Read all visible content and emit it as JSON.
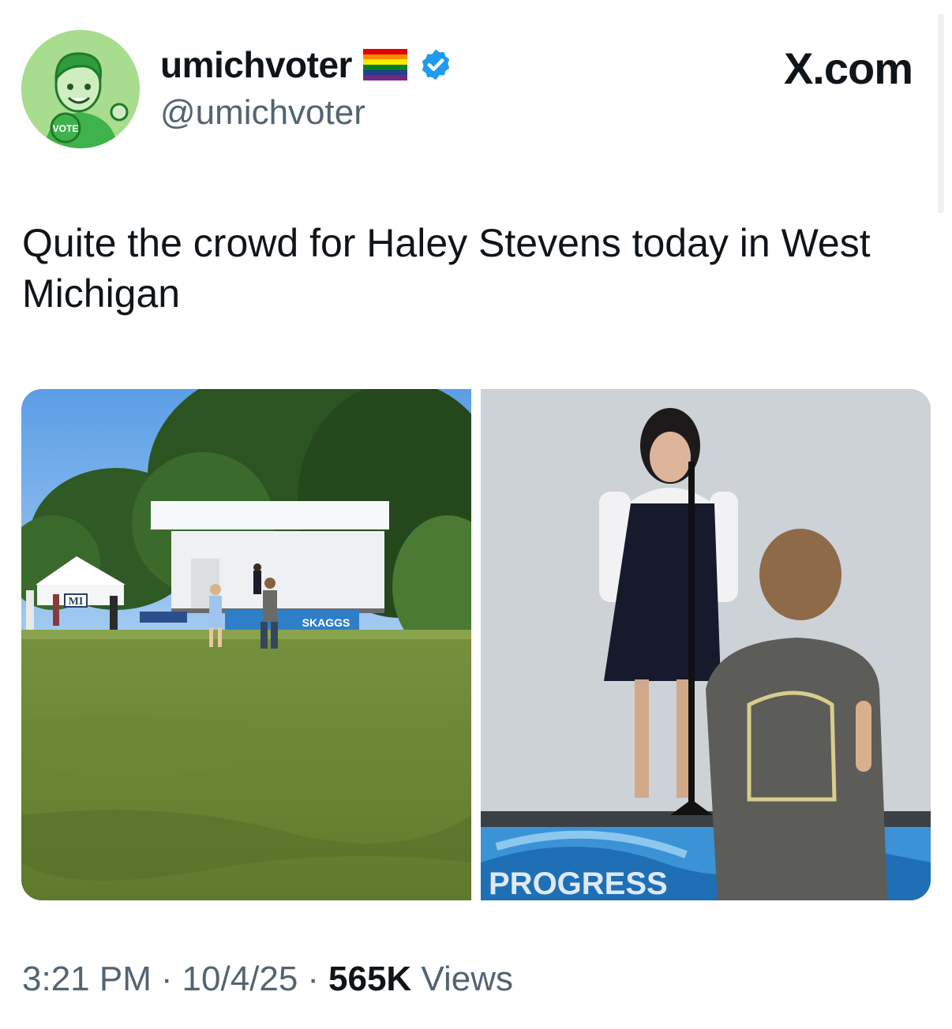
{
  "header": {
    "display_name": "umichvoter",
    "handle": "@umichvoter",
    "brand": "X.com",
    "avatar_badge": "VOTE",
    "flag_colors": [
      "#e40303",
      "#ff8c00",
      "#ffed00",
      "#008026",
      "#24408e",
      "#732982"
    ],
    "verified_color": "#1d9bf0"
  },
  "tweet": {
    "text": "Quite the crowd for Haley Stevens today in West Michigan"
  },
  "media": {
    "photo1": {
      "banner": "SKAGGS",
      "sign": "MI"
    },
    "photo2": {
      "banner": "PROGRESS"
    }
  },
  "footer": {
    "time": "3:21 PM",
    "separator": "·",
    "date": "10/4/25",
    "views_count": "565K",
    "views_label": "Views"
  }
}
